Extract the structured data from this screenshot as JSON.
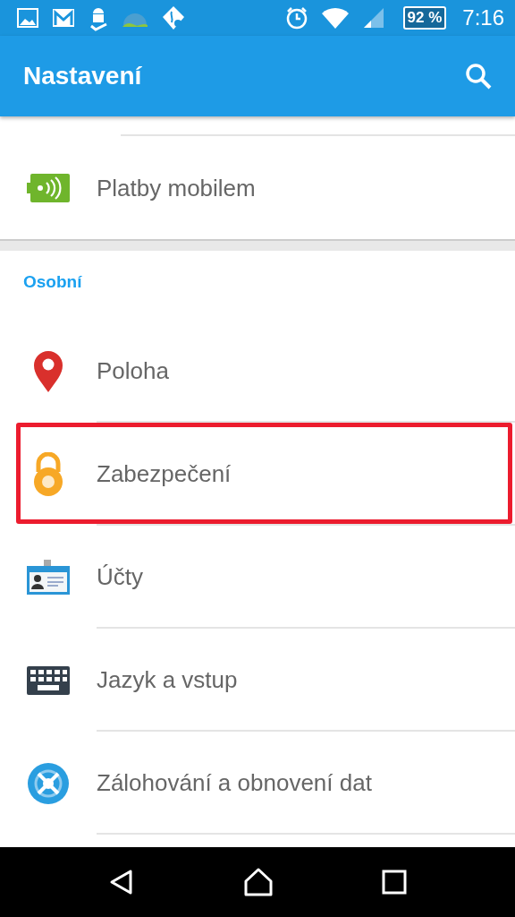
{
  "status_bar": {
    "battery": "92 %",
    "time": "7:16"
  },
  "app_bar": {
    "title": "Nastavení"
  },
  "sections": [
    {
      "items": [
        {
          "kind": "nfc",
          "label": "Platby mobilem",
          "highlighted": false
        }
      ]
    },
    {
      "header": "Osobní",
      "items": [
        {
          "kind": "location",
          "label": "Poloha",
          "highlighted": false
        },
        {
          "kind": "lock",
          "label": "Zabezpečení",
          "highlighted": true
        },
        {
          "kind": "accounts",
          "label": "Účty",
          "highlighted": false
        },
        {
          "kind": "keyboard",
          "label": "Jazyk a vstup",
          "highlighted": false
        },
        {
          "kind": "backup",
          "label": "Zálohování a obnovení dat",
          "highlighted": false
        }
      ]
    }
  ]
}
